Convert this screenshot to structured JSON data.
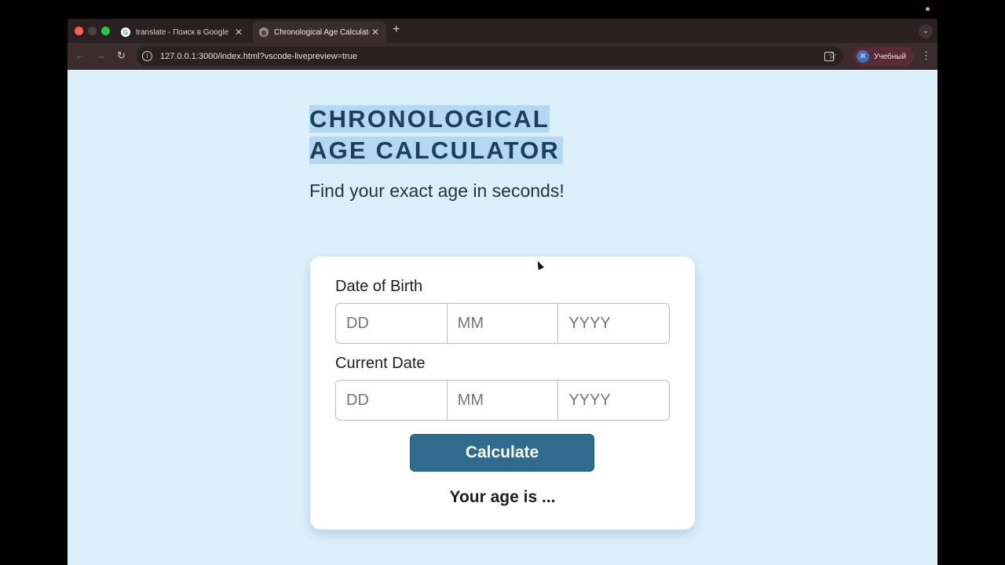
{
  "browser": {
    "tabs": [
      {
        "title": "translate - Поиск в Google",
        "favicon": "google-icon"
      },
      {
        "title": "Chronological Age Calculator",
        "favicon": "globe-icon",
        "active": true
      }
    ],
    "new_tab": "+",
    "url": "127.0.0.1:3000/index.html?vscode-livepreview=true",
    "profile": {
      "avatar_letter": "Ж",
      "name": "Учебный"
    }
  },
  "page": {
    "title": "CHRONOLOGICAL AGE CALCULATOR",
    "subtitle": "Find your exact age in seconds!"
  },
  "form": {
    "dob_label": "Date of Birth",
    "current_label": "Current Date",
    "placeholders": {
      "day": "DD",
      "month": "MM",
      "year": "YYYY"
    },
    "calculate_label": "Calculate",
    "result_text": "Your age is ..."
  },
  "colors": {
    "page_bg": "#dbf0fb",
    "title": "#17405a",
    "title_highlight": "#b5d7f2",
    "button": "#2e6b8d"
  }
}
